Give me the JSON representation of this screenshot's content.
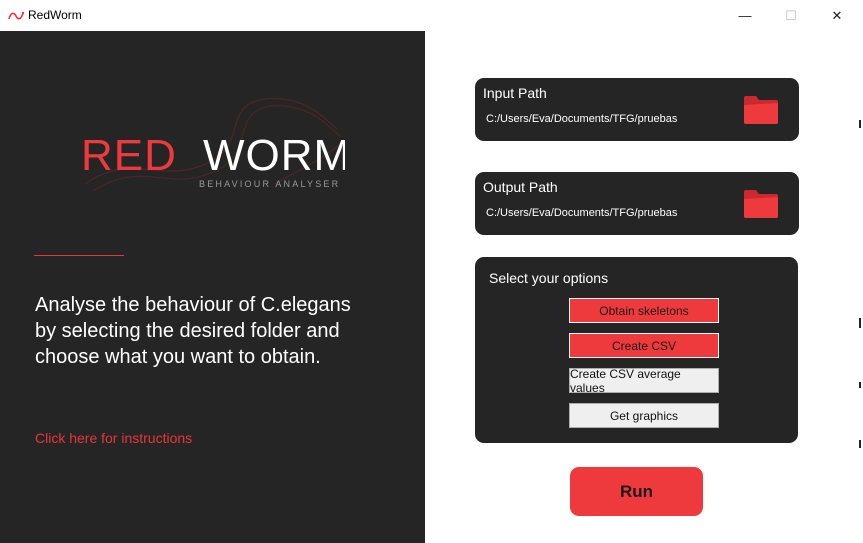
{
  "window": {
    "title": "RedWorm",
    "minimize_glyph": "—",
    "maximize_glyph": "☐",
    "close_glyph": "✕"
  },
  "left_panel": {
    "logo": {
      "word_red": "RED",
      "word_white": "WORM",
      "tagline": "BEHAVIOUR ANALYSER"
    },
    "description": "Analyse the behaviour of C.elegans by selecting the desired folder and choose what you want to obtain.",
    "instructions_link": "Click here for instructions"
  },
  "input_path": {
    "title": "Input Path",
    "value": "C:/Users/Eva/Documents/TFG/pruebas",
    "icon": "folder-icon"
  },
  "output_path": {
    "title": "Output Path",
    "value": "C:/Users/Eva/Documents/TFG/pruebas",
    "icon": "folder-icon"
  },
  "options": {
    "title": "Select your options",
    "buttons": [
      {
        "label": "Obtain skeletons",
        "selected": true
      },
      {
        "label": "Create CSV",
        "selected": true
      },
      {
        "label": "Create CSV average values",
        "selected": false
      },
      {
        "label": "Get graphics",
        "selected": false
      }
    ]
  },
  "run_button": {
    "label": "Run"
  },
  "colors": {
    "accent": "#ef3a3d",
    "panel_dark": "#252525",
    "text_light": "#ffffff"
  }
}
